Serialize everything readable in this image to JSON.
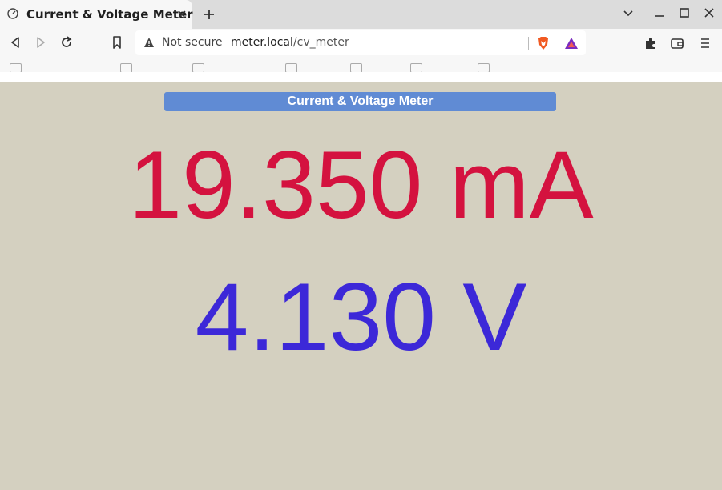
{
  "browser": {
    "tab": {
      "title": "Current & Voltage Meter",
      "icon": "speedometer-icon"
    },
    "address_bar": {
      "security_label": "Not secure",
      "host": "meter.local",
      "path": "/cv_meter"
    }
  },
  "page": {
    "header": "Current & Voltage Meter",
    "current": {
      "value": "19.350",
      "unit": "mA",
      "color": "#d4123f"
    },
    "voltage": {
      "value": "4.130",
      "unit": "V",
      "color": "#3c28d8"
    },
    "background": "#d4d0c0",
    "header_color": "#608bd4"
  }
}
